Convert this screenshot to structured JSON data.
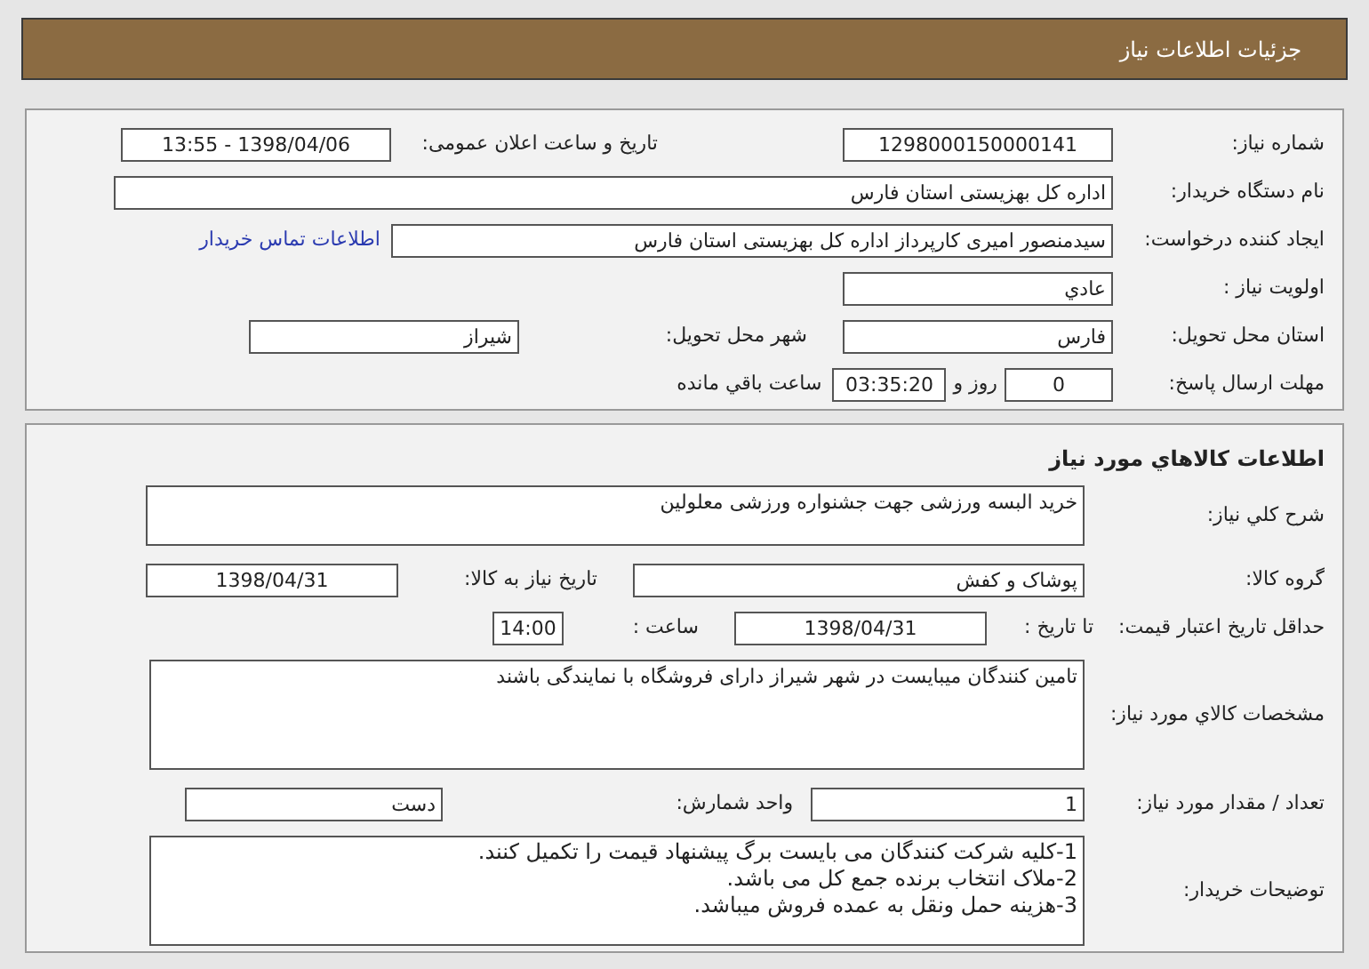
{
  "header": {
    "title": "جزئیات اطلاعات نیاز"
  },
  "need": {
    "number": {
      "label": "شماره نیاز:",
      "value": "1298000150000141"
    },
    "announce": {
      "label": "تاریخ و ساعت اعلان عمومی:",
      "value": "1398/04/06 - 13:55"
    },
    "buyer_org": {
      "label": "نام دستگاه خریدار:",
      "value": "اداره کل بهزیستی استان فارس"
    },
    "requester": {
      "label": "ایجاد کننده درخواست:",
      "value": "سیدمنصور امیری کارپرداز اداره کل بهزیستی استان فارس",
      "link": "اطلاعات تماس خریدار"
    },
    "priority": {
      "label": "اولویت نیاز :",
      "value": "عادي"
    },
    "province": {
      "label": "استان محل تحویل:",
      "value": "فارس"
    },
    "city": {
      "label": "شهر محل تحویل:",
      "value": "شیراز"
    },
    "deadline": {
      "label": "مهلت ارسال پاسخ:",
      "days": "0",
      "days_unit": "روز و",
      "time": "03:35:20",
      "suffix": "ساعت باقي مانده"
    }
  },
  "goods": {
    "title": "اطلاعات کالاهاي مورد نیاز",
    "description": {
      "label": "شرح کلي نیاز:",
      "value": "خرید البسه ورزشی جهت جشنواره ورزشی معلولین"
    },
    "group": {
      "label": "گروه کالا:",
      "value": "پوشاک و کفش"
    },
    "need_date": {
      "label": "تاریخ نیاز به کالا:",
      "value": "1398/04/31"
    },
    "validity": {
      "label": "حداقل تاریخ اعتبار قیمت:",
      "to_label": "تا تاریخ :",
      "date": "1398/04/31",
      "time_label": "ساعت :",
      "time": "14:00"
    },
    "specs": {
      "label": "مشخصات کالاي مورد نیاز:",
      "value": "تامین کنندگان میبایست در شهر شیراز دارای فروشگاه  با نمایندگی باشند"
    },
    "quantity": {
      "label": "تعداد / مقدار مورد نیاز:",
      "value": "1"
    },
    "unit": {
      "label": "واحد شمارش:",
      "value": "دست"
    },
    "notes": {
      "label": "توضیحات خریدار:",
      "lines": [
        "1-کلیه شرکت کنندگان می بایست برگ پیشنهاد قیمت را تکمیل کنند.",
        "2-ملاک انتخاب برنده جمع کل می باشد.",
        "3-هزینه حمل ونقل به عمده فروش میباشد."
      ]
    }
  }
}
